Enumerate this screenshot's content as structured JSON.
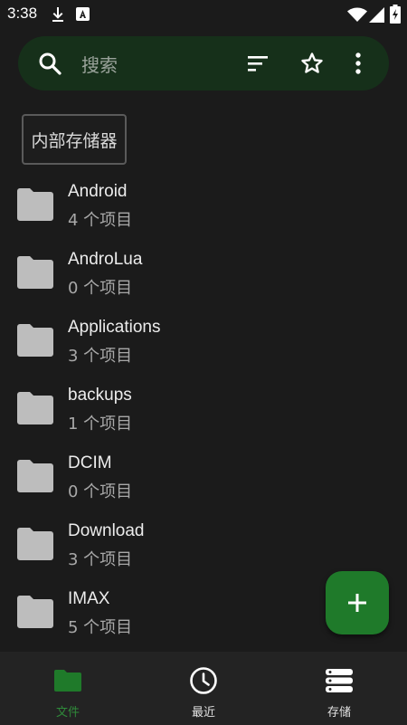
{
  "status_bar": {
    "time": "3:38",
    "icons": [
      "download-icon",
      "app-notification-icon",
      "wifi-icon",
      "signal-icon",
      "battery-charging-icon"
    ]
  },
  "search": {
    "placeholder": "搜索",
    "actions": [
      "search-icon",
      "sort-icon",
      "star-icon",
      "more-icon"
    ]
  },
  "breadcrumb": {
    "label": "内部存储器"
  },
  "files": [
    {
      "name": "Android",
      "count": "4 个项目",
      "icon": "folder-icon"
    },
    {
      "name": "AndroLua",
      "count": "0 个项目",
      "icon": "folder-icon"
    },
    {
      "name": "Applications",
      "count": "3 个项目",
      "icon": "folder-icon"
    },
    {
      "name": "backups",
      "count": "1 个项目",
      "icon": "folder-icon"
    },
    {
      "name": "DCIM",
      "count": "0 个项目",
      "icon": "folder-icon"
    },
    {
      "name": "Download",
      "count": "3 个项目",
      "icon": "folder-icon"
    },
    {
      "name": "IMAX",
      "count": "5 个项目",
      "icon": "folder-icon"
    }
  ],
  "fab": {
    "icon": "plus-icon"
  },
  "bottom_nav": {
    "items": [
      {
        "label": "文件",
        "icon": "folder-icon",
        "active": true
      },
      {
        "label": "最近",
        "icon": "clock-icon",
        "active": false
      },
      {
        "label": "存储",
        "icon": "storage-icon",
        "active": false
      }
    ]
  },
  "colors": {
    "background": "#1b1b1b",
    "search_bar": "#16301a",
    "accent": "#1f7a2a",
    "active_nav": "#2f8a3a",
    "folder": "#bdbdbd",
    "bottom_nav": "#232323"
  }
}
